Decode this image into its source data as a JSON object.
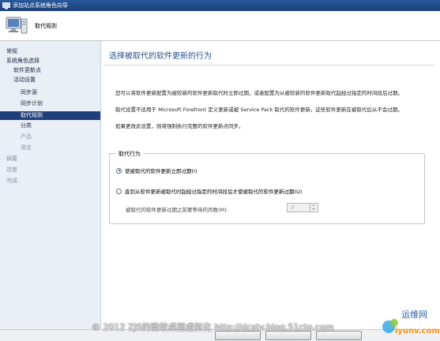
{
  "window": {
    "title": "添加站点系统角色向导"
  },
  "header": {
    "title": "取代规则"
  },
  "sidebar": {
    "items": [
      {
        "label": "常规"
      },
      {
        "label": "系统角色选择"
      },
      {
        "label": "软件更新点"
      },
      {
        "label": "活动设置"
      },
      {
        "label": "同步源"
      },
      {
        "label": "同步计划"
      },
      {
        "label": "取代规则"
      },
      {
        "label": "分类"
      },
      {
        "label": "产品"
      },
      {
        "label": "语言"
      },
      {
        "label": "摘要"
      },
      {
        "label": "进度"
      },
      {
        "label": "完成"
      }
    ]
  },
  "main": {
    "heading": "选择被取代的软件更新的行为",
    "para1": "您可以将软件更新配置为被较新的软件更新取代时立即过期，或者配置为从被较新的软件更新取代起经过指定的时间段后过期。",
    "para2": "取代设置不适用于 Microsoft Forefront 定义更新或被 Service Pack 取代的软件更新。这些软件更新在被取代后从不会过期。",
    "para3": "如果更改此设置，则将强制执行完整的软件更新点同步。",
    "group": {
      "legend": "取代行为",
      "option1": "使被取代的软件更新立即过期(I)",
      "option2": "直到从软件更新被取代时起经过指定的时间段后才使被取代的软件更新过期(U)",
      "months_label": "被取代的软件更新过期之前要等待的月数(M):",
      "months_value": "3"
    }
  },
  "watermark": {
    "text": "© 2012 ZJS的微软桌面虚拟化 http://dcstv.blog.51cto.com"
  },
  "logo": {
    "line1": "运维网",
    "line2": "iyunv.com"
  }
}
